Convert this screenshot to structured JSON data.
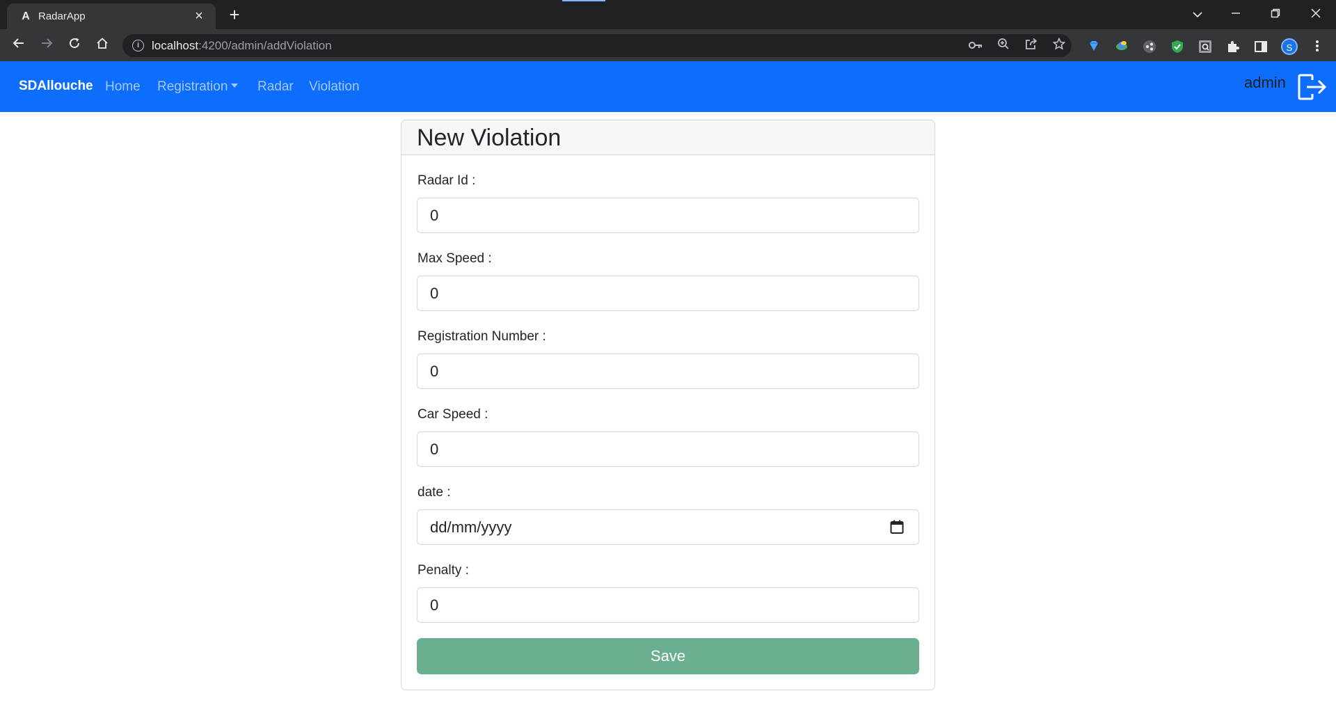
{
  "browser": {
    "tab_title": "RadarApp",
    "tab_favicon": "angular-icon",
    "tab_close": "×",
    "new_tab": "+",
    "url_host": "localhost",
    "url_path": ":4200/admin/addViolation",
    "profile_initial": "S"
  },
  "navbar": {
    "brand": "SDAllouche",
    "links": [
      "Home",
      "Registration",
      "Radar",
      "Violation"
    ],
    "user": "admin",
    "bg_color": "#0d6efd"
  },
  "form": {
    "title": "New Violation",
    "fields": [
      {
        "label": "Radar Id :",
        "value": "0"
      },
      {
        "label": "Max Speed :",
        "value": "0"
      },
      {
        "label": "Registration Number :",
        "value": "0"
      },
      {
        "label": "Car Speed :",
        "value": "0"
      },
      {
        "label": "date :",
        "value": "dd/mm/yyyy"
      },
      {
        "label": "Penalty :",
        "value": "0"
      }
    ],
    "save_label": "Save",
    "save_color": "#6ab090"
  }
}
